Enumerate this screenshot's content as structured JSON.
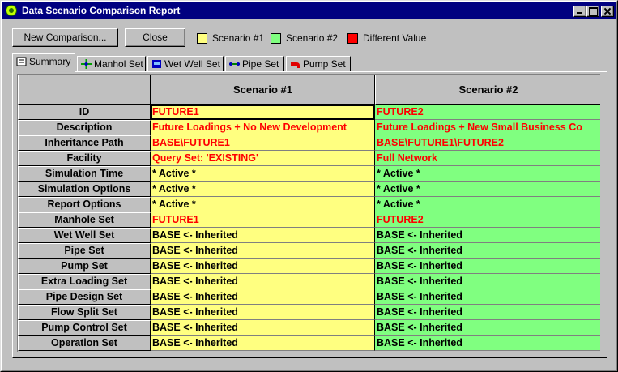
{
  "window": {
    "title": "Data Scenario Comparison Report"
  },
  "toolbar": {
    "new_label": "New Comparison...",
    "close_label": "Close"
  },
  "legend": [
    {
      "label": "Scenario #1",
      "color": "#ffff80"
    },
    {
      "label": "Scenario #2",
      "color": "#80ff80"
    },
    {
      "label": "Different Value",
      "color": "#ff0000"
    }
  ],
  "tabs": [
    {
      "label": "Summary",
      "icon": "summary-icon"
    },
    {
      "label": "Manhol Set",
      "icon": "manhole-icon"
    },
    {
      "label": "Wet Well Set",
      "icon": "wet-well-icon"
    },
    {
      "label": "Pipe Set",
      "icon": "pipe-icon"
    },
    {
      "label": "Pump Set",
      "icon": "pump-icon"
    }
  ],
  "grid": {
    "columns": [
      "Scenario #1",
      "Scenario #2"
    ],
    "rows": [
      {
        "label": "ID",
        "s1": "FUTURE1",
        "s2": "FUTURE2",
        "diff": true
      },
      {
        "label": "Description",
        "s1": "Future Loadings + No New Development",
        "s2": "Future Loadings + New Small Business Co",
        "diff": true
      },
      {
        "label": "Inheritance Path",
        "s1": "BASE\\FUTURE1",
        "s2": "BASE\\FUTURE1\\FUTURE2",
        "diff": true
      },
      {
        "label": "Facility",
        "s1": "Query Set: 'EXISTING'",
        "s2": "Full Network",
        "diff": true
      },
      {
        "label": "Simulation Time",
        "s1": "* Active *",
        "s2": "* Active *",
        "diff": false
      },
      {
        "label": "Simulation Options",
        "s1": "* Active *",
        "s2": "* Active *",
        "diff": false
      },
      {
        "label": "Report Options",
        "s1": "* Active *",
        "s2": "* Active *",
        "diff": false
      },
      {
        "label": "Manhole Set",
        "s1": "FUTURE1",
        "s2": "FUTURE2",
        "diff": true
      },
      {
        "label": "Wet Well Set",
        "s1": "BASE <- Inherited",
        "s2": "BASE <- Inherited",
        "diff": false
      },
      {
        "label": "Pipe Set",
        "s1": "BASE <- Inherited",
        "s2": "BASE <- Inherited",
        "diff": false
      },
      {
        "label": "Pump Set",
        "s1": "BASE <- Inherited",
        "s2": "BASE <- Inherited",
        "diff": false
      },
      {
        "label": "Extra Loading Set",
        "s1": "BASE <- Inherited",
        "s2": "BASE <- Inherited",
        "diff": false
      },
      {
        "label": "Pipe Design Set",
        "s1": "BASE <- Inherited",
        "s2": "BASE <- Inherited",
        "diff": false
      },
      {
        "label": "Flow Split Set",
        "s1": "BASE <- Inherited",
        "s2": "BASE <- Inherited",
        "diff": false
      },
      {
        "label": "Pump Control Set",
        "s1": "BASE <- Inherited",
        "s2": "BASE <- Inherited",
        "diff": false
      },
      {
        "label": "Operation Set",
        "s1": "BASE <- Inherited",
        "s2": "BASE <- Inherited",
        "diff": false
      }
    ]
  }
}
